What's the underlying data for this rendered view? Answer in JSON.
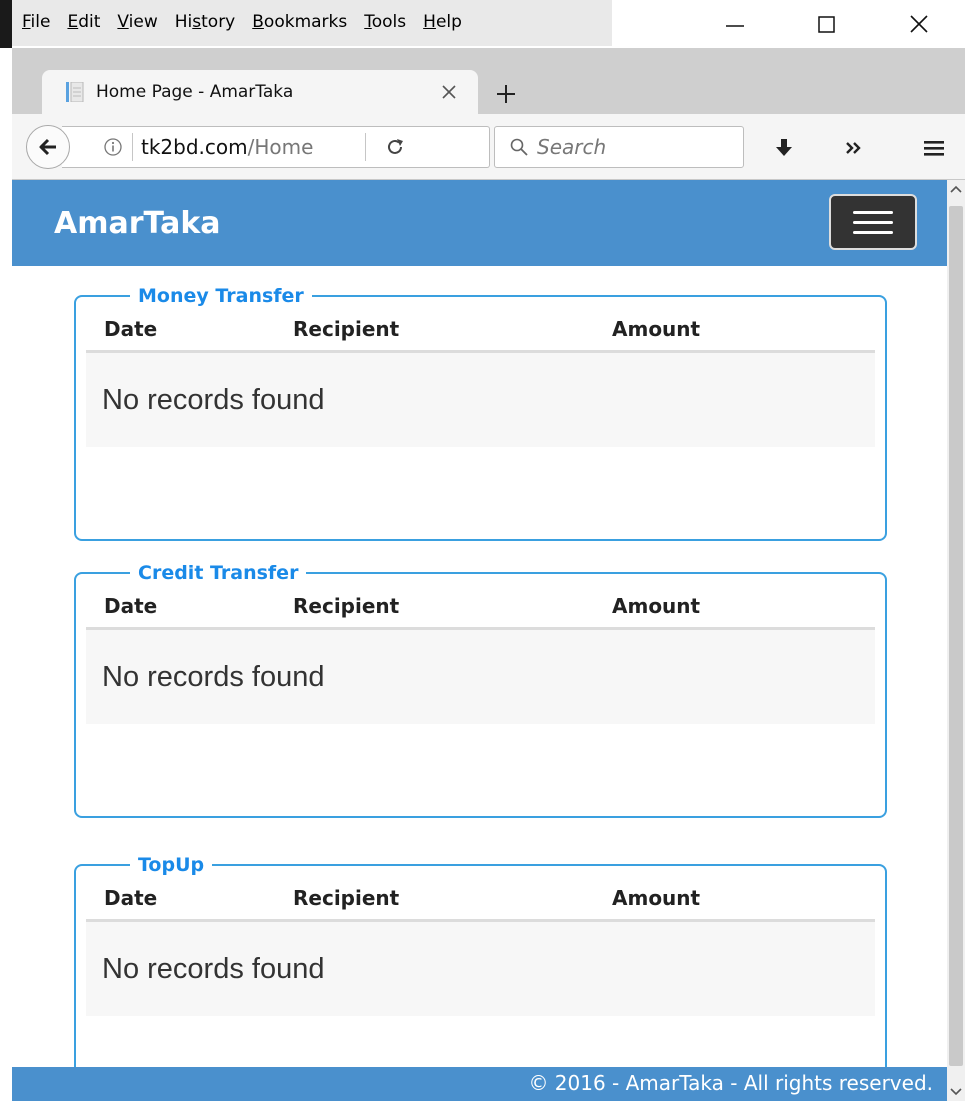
{
  "menubar": {
    "items": [
      {
        "label": "File",
        "accel": "F",
        "rest": "ile"
      },
      {
        "label": "Edit",
        "accel": "E",
        "rest": "dit"
      },
      {
        "label": "View",
        "accel": "V",
        "rest": "iew"
      },
      {
        "label": "History",
        "accel": "",
        "rest": ""
      },
      {
        "label": "Bookmarks",
        "accel": "B",
        "rest": "ookmarks"
      },
      {
        "label": "Tools",
        "accel": "T",
        "rest": "ools"
      },
      {
        "label": "Help",
        "accel": "H",
        "rest": "elp"
      }
    ],
    "history_pre": "Hi",
    "history_accel": "s",
    "history_post": "tory"
  },
  "tab": {
    "title": "Home Page - AmarTaka"
  },
  "urlbar": {
    "host": "tk2bd.com",
    "path": "/Home"
  },
  "searchbar": {
    "placeholder": "Search"
  },
  "site": {
    "brand": "AmarTaka",
    "columns": {
      "date": "Date",
      "recipient": "Recipient",
      "amount": "Amount"
    },
    "panels": [
      {
        "title": "Money Transfer",
        "empty": "No records found"
      },
      {
        "title": "Credit Transfer",
        "empty": "No records found"
      },
      {
        "title": "TopUp",
        "empty": "No records found"
      }
    ],
    "footer": "© 2016 - AmarTaka - All rights reserved."
  },
  "colors": {
    "accent": "#4a90cd",
    "legend": "#1a8ae8",
    "panel_border": "#3aa0e0"
  }
}
